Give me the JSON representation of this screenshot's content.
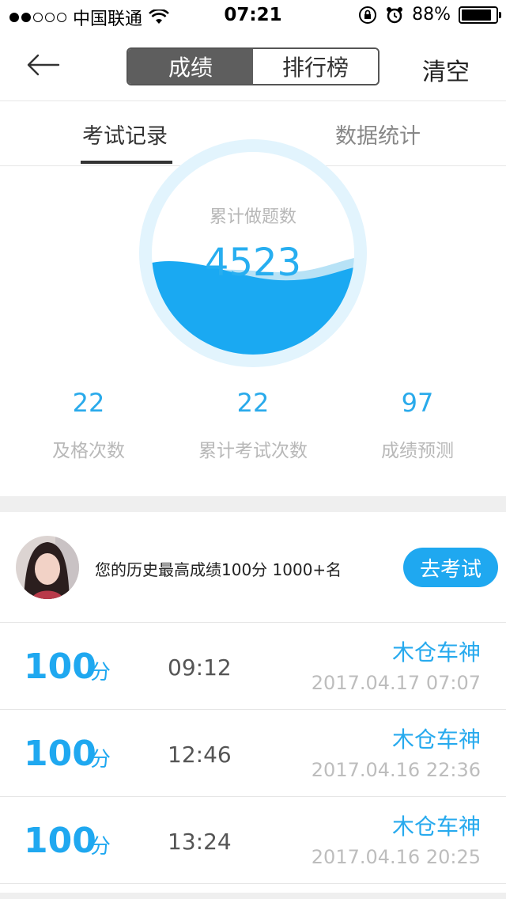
{
  "status_bar": {
    "carrier": "中国联通",
    "time": "07:21",
    "battery": "88%",
    "battery_level": 0.88,
    "signal_bars": 2
  },
  "nav": {
    "segments": [
      "成绩",
      "排行榜"
    ],
    "active_segment": 0,
    "clear_label": "清空"
  },
  "tabs": {
    "items": [
      "考试记录",
      "数据统计"
    ],
    "active": 0
  },
  "gauge": {
    "label": "累计做题数",
    "value": "4523",
    "fill_level": 0.55
  },
  "stats": [
    {
      "value": "22",
      "label": "及格次数"
    },
    {
      "value": "22",
      "label": "累计考试次数"
    },
    {
      "value": "97",
      "label": "成绩预测"
    }
  ],
  "best": {
    "text": "您的历史最高成绩100分  1000+名",
    "button_label": "去考试"
  },
  "records": [
    {
      "score": "100",
      "unit": "分",
      "duration": "09:12",
      "name": "木仓车神",
      "datetime": "2017.04.17 07:07"
    },
    {
      "score": "100",
      "unit": "分",
      "duration": "12:46",
      "name": "木仓车神",
      "datetime": "2017.04.16 22:36"
    },
    {
      "score": "100",
      "unit": "分",
      "duration": "13:24",
      "name": "木仓车神",
      "datetime": "2017.04.16 20:25"
    }
  ],
  "colors": {
    "accent": "#1fa8f0",
    "segment_active": "#5e5e5e",
    "gauge_ring": "#e2f4fd"
  }
}
